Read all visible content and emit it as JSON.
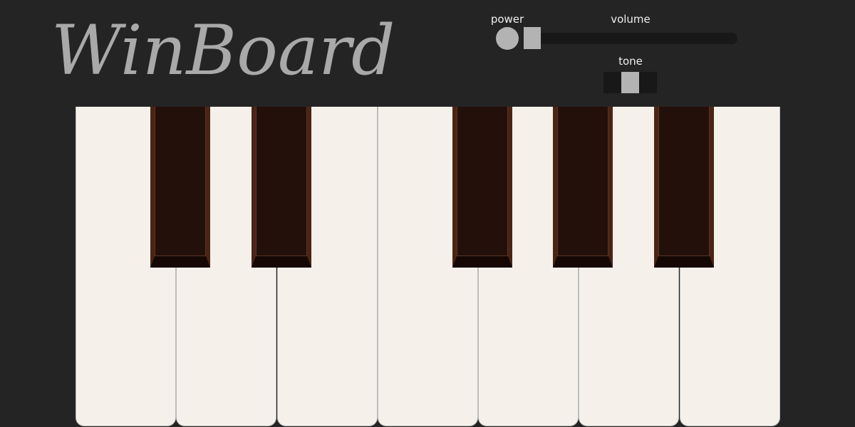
{
  "app": {
    "logo_text": "WinBoard"
  },
  "controls": {
    "power": {
      "label": "power",
      "on": false
    },
    "volume": {
      "label": "volume",
      "value": 0.0
    },
    "tone": {
      "label": "tone",
      "position": 1,
      "positions": 3
    }
  },
  "keyboard": {
    "white_keys": 7,
    "black_keys": [
      0,
      1,
      3,
      4,
      5
    ]
  },
  "colors": {
    "background": "#242424",
    "logo": "#a9a9a9",
    "control": "#b3b3b3",
    "track": "#181818",
    "white_key": "#f5f1ea",
    "black_key": "#23100a",
    "black_key_bevel": "#4a2415"
  }
}
